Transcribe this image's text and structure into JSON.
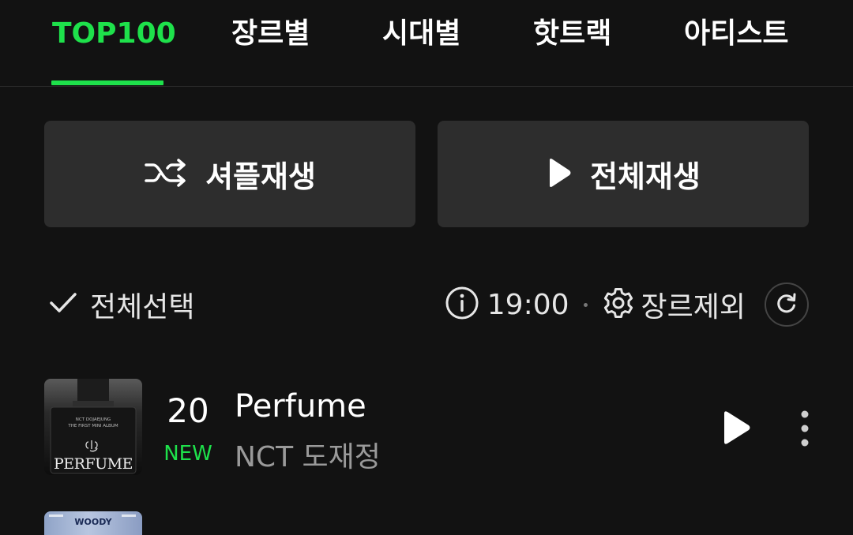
{
  "tabs": [
    {
      "label": "TOP100",
      "active": true
    },
    {
      "label": "장르별"
    },
    {
      "label": "시대별"
    },
    {
      "label": "핫트랙"
    },
    {
      "label": "아티스트"
    }
  ],
  "actions": {
    "shuffle_label": "셔플재생",
    "play_all_label": "전체재생"
  },
  "toolbar": {
    "select_all_label": "전체선택",
    "time": "19:00",
    "genre_exclude_label": "장르제외"
  },
  "tracks": [
    {
      "rank": "20",
      "badge": "NEW",
      "title": "Perfume",
      "artist": "NCT 도재정",
      "cover_lines": [
        "NCT DOJAEJUNG",
        "THE FIRST MINI ALBUM"
      ],
      "cover_title": "PERFUME"
    }
  ],
  "next_cover_label": "WOODY",
  "colors": {
    "accent": "#1ee14b",
    "background": "#121212",
    "button": "#2d2d2d"
  }
}
